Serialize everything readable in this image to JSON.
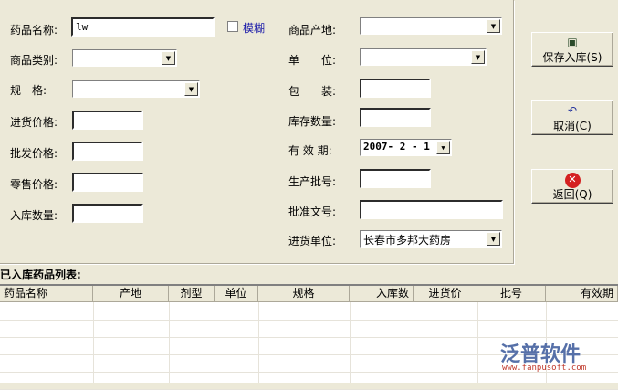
{
  "form": {
    "drug_name_label": "药品名称:",
    "drug_name_value": "lw",
    "fuzzy_label": "模糊",
    "category_label": "商品类别:",
    "spec_label": "规　格:",
    "purchase_price_label": "进货价格:",
    "wholesale_price_label": "批发价格:",
    "retail_price_label": "零售价格:",
    "in_qty_label": "入库数量:",
    "origin_label": "商品产地:",
    "unit_label": "单　　位:",
    "package_label": "包　　装:",
    "stock_qty_label": "库存数量:",
    "expiry_label": "有 效 期:",
    "expiry_value": "2007- 2 - 1",
    "batch_label": "生产批号:",
    "approval_label": "批准文号:",
    "supplier_label": "进货单位:",
    "supplier_value": "长春市多邦大药房"
  },
  "buttons": {
    "save": "保存入库(S)",
    "cancel": "取消(C)",
    "back": "返回(Q)"
  },
  "list": {
    "title": "已入库药品列表:",
    "columns": [
      "药品名称",
      "产地",
      "剂型",
      "单位",
      "规格",
      "入库数",
      "进货价",
      "批号",
      "有效期"
    ]
  },
  "watermark": {
    "brand": "泛普软件",
    "url": "www.fanpusoft.com"
  }
}
